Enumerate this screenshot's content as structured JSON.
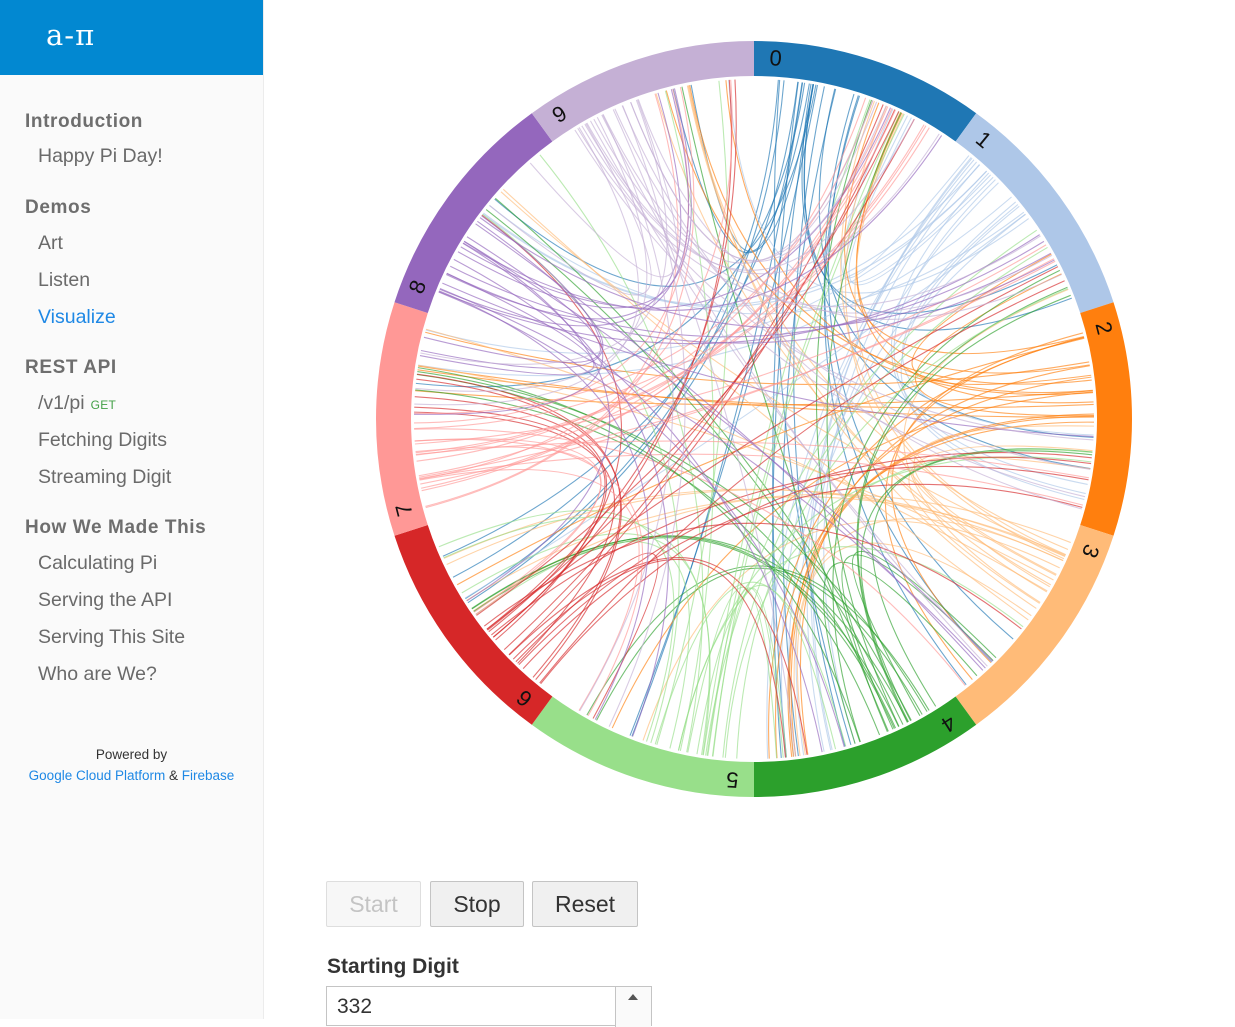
{
  "logo": {
    "text": "a-π"
  },
  "nav": {
    "introduction": {
      "title": "Introduction",
      "items": [
        "Happy Pi Day!"
      ]
    },
    "demos": {
      "title": "Demos",
      "items": [
        "Art",
        "Listen",
        "Visualize"
      ],
      "active": "Visualize"
    },
    "rest_api": {
      "title": "REST API",
      "endpoint": "/v1/pi",
      "endpoint_badge": "GET",
      "items": [
        "Fetching Digits",
        "Streaming Digit"
      ]
    },
    "how": {
      "title": "How We Made This",
      "items": [
        "Calculating Pi",
        "Serving the API",
        "Serving This Site",
        "Who are We?"
      ]
    }
  },
  "footer": {
    "powered_by": "Powered by",
    "link1": "Google Cloud Platform",
    "amp": "&",
    "link2": "Firebase"
  },
  "chart_data": {
    "type": "chord",
    "groups": [
      "0",
      "1",
      "2",
      "3",
      "4",
      "5",
      "6",
      "7",
      "8",
      "9"
    ],
    "colors": [
      "#1f77b4",
      "#aec7e8",
      "#ff7f0e",
      "#ffbb78",
      "#2ca02c",
      "#98df8a",
      "#d62728",
      "#ff9896",
      "#9467bd",
      "#c5b0d5"
    ]
  },
  "controls": {
    "start_label": "Start",
    "stop_label": "Stop",
    "reset_label": "Reset",
    "starting_digit_label": "Starting Digit",
    "starting_digit_value": "332"
  },
  "icons": {
    "spinner": "spinner-up-icon"
  }
}
